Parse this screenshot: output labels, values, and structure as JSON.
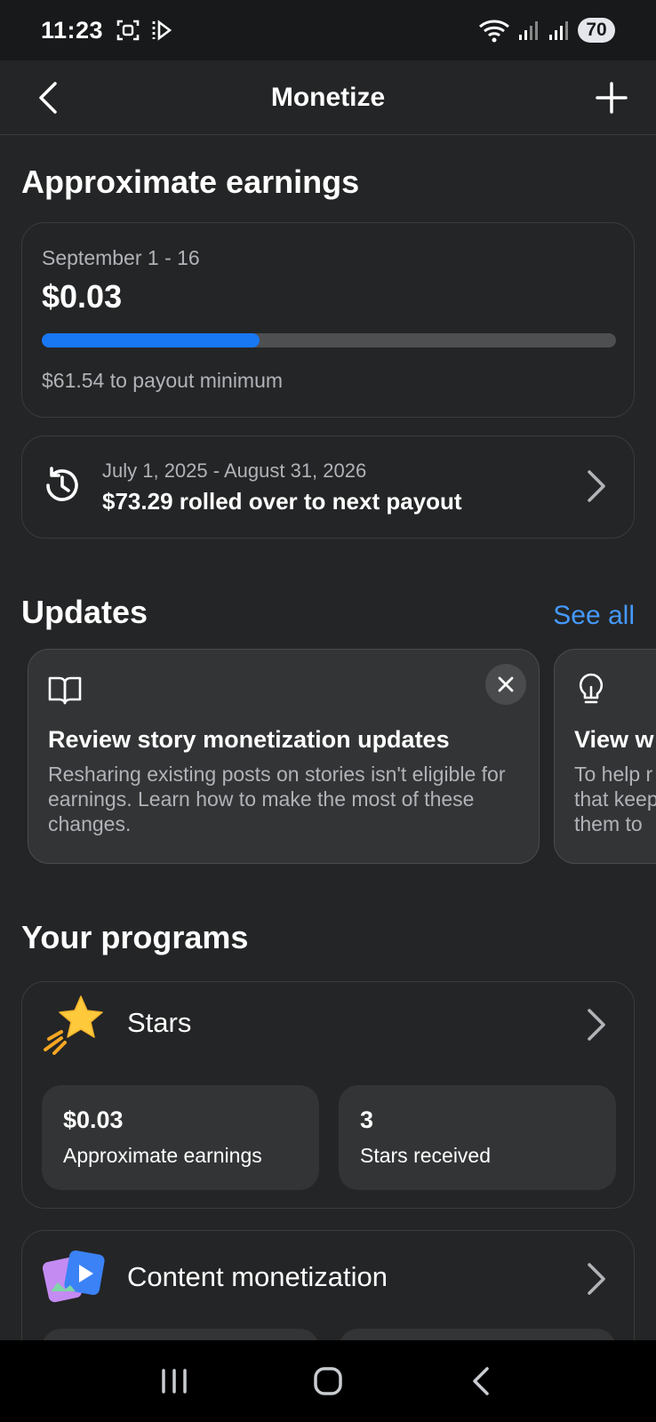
{
  "status_bar": {
    "time": "11:23",
    "battery": "70"
  },
  "header": {
    "title": "Monetize"
  },
  "earnings": {
    "section_title": "Approximate earnings",
    "period": "September 1 - 16",
    "amount": "$0.03",
    "progress_percent": 38,
    "remaining": "$61.54 to payout minimum"
  },
  "rollover": {
    "dates": "July 1, 2025 - August 31, 2026",
    "text": "$73.29 rolled over to next payout"
  },
  "updates": {
    "section_title": "Updates",
    "see_all": "See all",
    "cards": [
      {
        "icon": "book-icon",
        "title": "Review story monetization updates",
        "body": "Resharing existing posts on stories isn't eligible for earnings. Learn how to make the most of these changes."
      },
      {
        "icon": "lightbulb-icon",
        "title": "View w",
        "body": "To help r that keep them to"
      }
    ]
  },
  "programs": {
    "section_title": "Your programs",
    "stars": {
      "name": "Stars",
      "icon": "star-icon",
      "stats": [
        {
          "value": "$0.03",
          "label": "Approximate earnings"
        },
        {
          "value": "3",
          "label": "Stars received"
        }
      ]
    },
    "content": {
      "name": "Content monetization",
      "icon": "media-icon"
    }
  }
}
